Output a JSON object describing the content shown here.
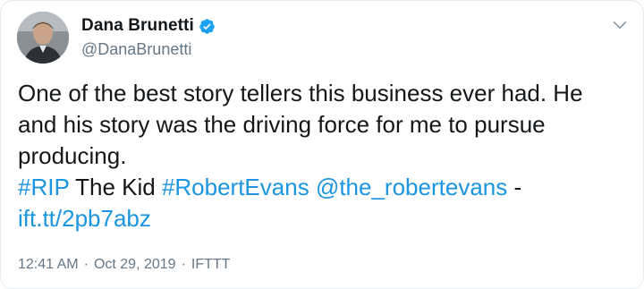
{
  "author": {
    "name": "Dana Brunetti",
    "handle": "@DanaBrunetti",
    "verified": true
  },
  "tweet": {
    "line1": "One of the best story tellers this business ever had. He",
    "line2": "and his story was the driving force for me to pursue",
    "line3": "producing.",
    "hashtag_rip": "#RIP",
    "plain_the_kid": " The Kid ",
    "hashtag_robertevans": "#RobertEvans",
    "space1": " ",
    "mention": "@the_robertevans",
    "dash": " -",
    "link": "ift.tt/2pb7abz"
  },
  "meta": {
    "time": "12:41 AM",
    "separator1": "·",
    "date": "Oct 29, 2019",
    "separator2": "·",
    "source": "IFTTT"
  },
  "icons": {
    "verified": "verified-badge-icon",
    "menu": "chevron-down-icon"
  },
  "colors": {
    "link": "#1b95e0",
    "text": "#14171a",
    "secondary": "#657786",
    "verified": "#1da1f2"
  }
}
